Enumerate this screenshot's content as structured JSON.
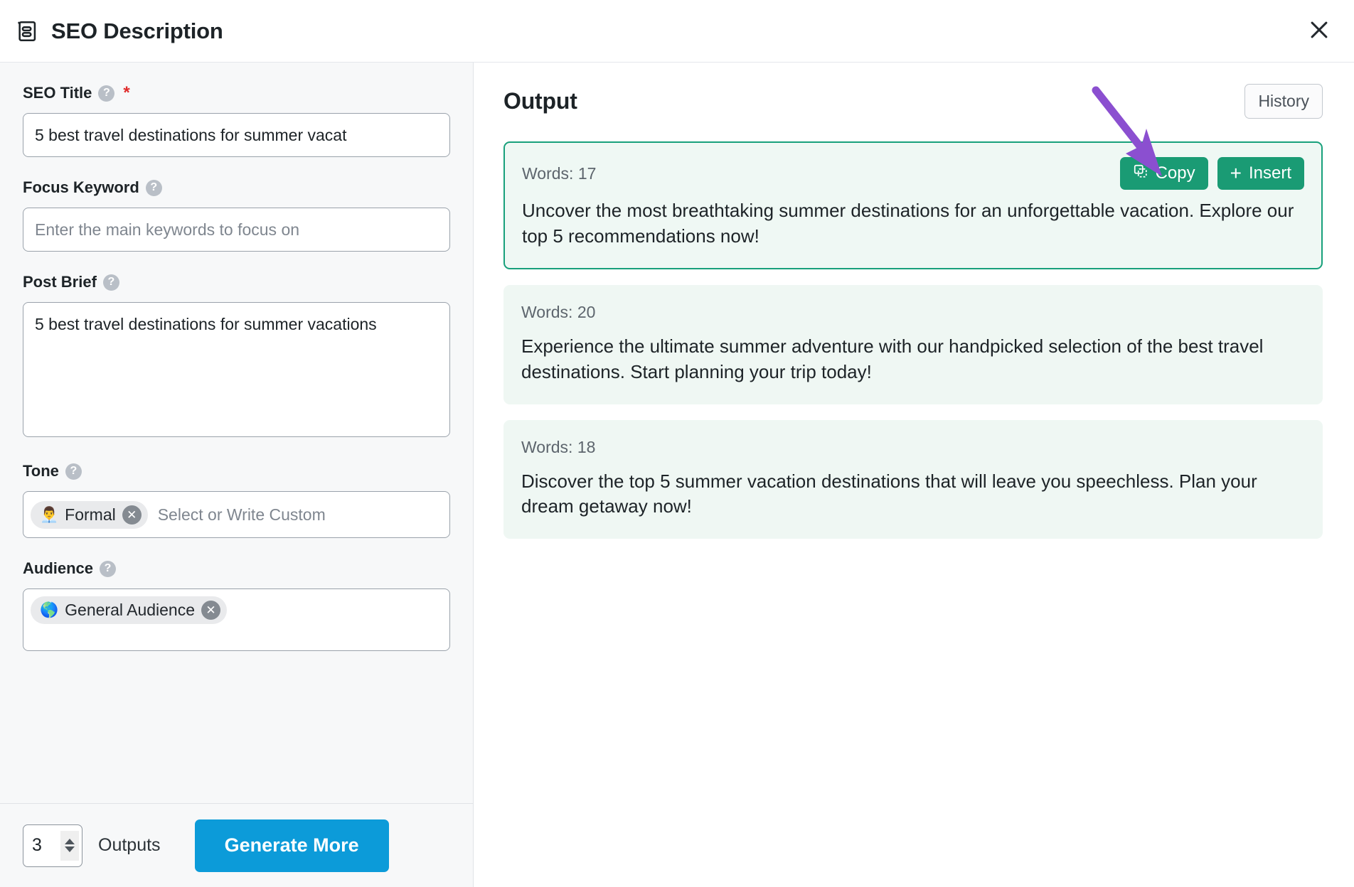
{
  "header": {
    "title": "SEO Description",
    "doc_icon": "description-icon",
    "close_icon": "close-icon"
  },
  "form": {
    "seo_title": {
      "label": "SEO Title",
      "help_icon": "help-circle-icon",
      "required_marker": "*",
      "value": "5 best travel destinations for summer vacat",
      "placeholder": ""
    },
    "focus_keyword": {
      "label": "Focus Keyword",
      "help_icon": "help-circle-icon",
      "value": "",
      "placeholder": "Enter the main keywords to focus on"
    },
    "post_brief": {
      "label": "Post Brief",
      "help_icon": "help-circle-icon",
      "value": "5 best travel destinations for summer vacations",
      "placeholder": ""
    },
    "tone": {
      "label": "Tone",
      "help_icon": "help-circle-icon",
      "chips": [
        {
          "emoji": "👨‍💼",
          "label": "Formal",
          "remove_icon": "close-circle-icon"
        }
      ],
      "placeholder": "Select or Write Custom"
    },
    "audience": {
      "label": "Audience",
      "help_icon": "help-circle-icon",
      "chips": [
        {
          "emoji": "🌎",
          "label": "General Audience",
          "remove_icon": "close-circle-icon"
        }
      ],
      "placeholder": ""
    }
  },
  "bottom_bar": {
    "outputs_count": "3",
    "outputs_label": "Outputs",
    "generate_label": "Generate More",
    "stepper_up_icon": "chevron-up-icon",
    "stepper_down_icon": "chevron-down-icon"
  },
  "output": {
    "title": "Output",
    "history_label": "History",
    "copy_label": "Copy",
    "copy_icon": "copy-icon",
    "insert_label": "Insert",
    "insert_icon": "plus-icon",
    "cards": [
      {
        "words_label": "Words: 17",
        "text": "Uncover the most breathtaking summer destinations for an unforgettable vacation. Explore our top 5 recommendations now!",
        "selected": true,
        "has_actions": true
      },
      {
        "words_label": "Words: 20",
        "text": "Experience the ultimate summer adventure with our handpicked selection of the best travel destinations. Start planning your trip today!",
        "selected": false,
        "has_actions": false
      },
      {
        "words_label": "Words: 18",
        "text": "Discover the top 5 summer vacation destinations that will leave you speechless. Plan your dream getaway now!",
        "selected": false,
        "has_actions": false
      }
    ]
  },
  "annotation": {
    "arrow_icon": "arrow-pointer-annotation",
    "color": "#8b4fd0"
  },
  "colors": {
    "accent_blue": "#0c9bd9",
    "accent_green": "#1a9b74",
    "card_border_green": "#18a07b",
    "card_bg": "#eff7f3",
    "panel_bg": "#f7f8f9",
    "required_red": "#e02b2b",
    "annotation_purple": "#8b4fd0"
  }
}
